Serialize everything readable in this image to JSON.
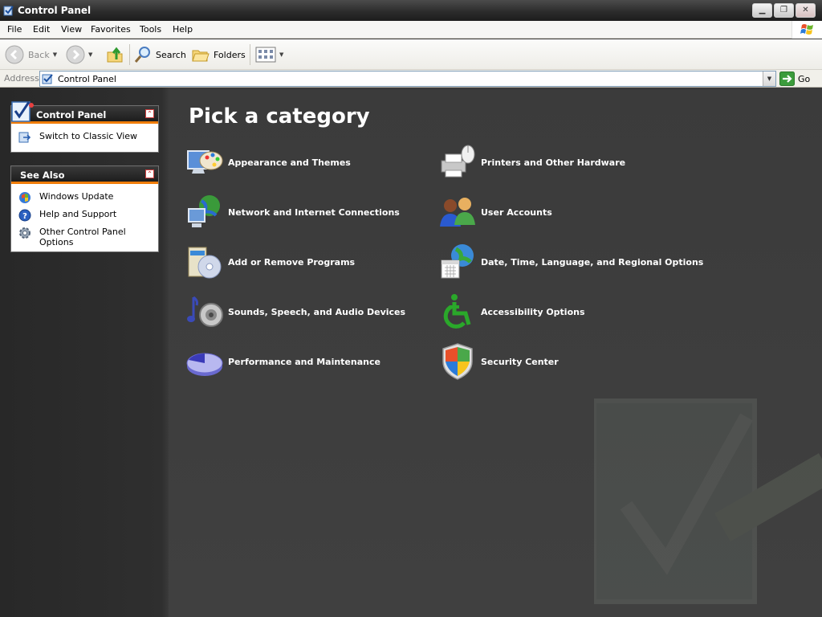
{
  "window": {
    "title": "Control Panel"
  },
  "menu": {
    "items": [
      "File",
      "Edit",
      "View",
      "Favorites",
      "Tools",
      "Help"
    ]
  },
  "toolbar": {
    "back": "Back",
    "search": "Search",
    "folders": "Folders"
  },
  "address": {
    "label": "Address",
    "value": "Control Panel",
    "go": "Go"
  },
  "sidebar": {
    "control_panel": {
      "title": "Control Panel",
      "switch_view": "Switch to Classic View"
    },
    "see_also": {
      "title": "See Also",
      "items": [
        "Windows Update",
        "Help and Support",
        "Other Control Panel Options"
      ]
    }
  },
  "main": {
    "heading": "Pick a category",
    "categories": [
      {
        "label": "Appearance and Themes",
        "icon": "appearance-icon"
      },
      {
        "label": "Printers and Other Hardware",
        "icon": "printer-icon"
      },
      {
        "label": "Network and Internet Connections",
        "icon": "network-icon"
      },
      {
        "label": "User Accounts",
        "icon": "users-icon"
      },
      {
        "label": "Add or Remove Programs",
        "icon": "programs-icon"
      },
      {
        "label": "Date, Time, Language, and Regional Options",
        "icon": "globe-calendar-icon"
      },
      {
        "label": "Sounds, Speech, and Audio Devices",
        "icon": "sound-icon"
      },
      {
        "label": "Accessibility Options",
        "icon": "accessibility-icon"
      },
      {
        "label": "Performance and Maintenance",
        "icon": "performance-icon"
      },
      {
        "label": "Security Center",
        "icon": "shield-icon"
      }
    ]
  },
  "colors": {
    "accent": "#f07d0a",
    "background": "#3b3b3b"
  }
}
